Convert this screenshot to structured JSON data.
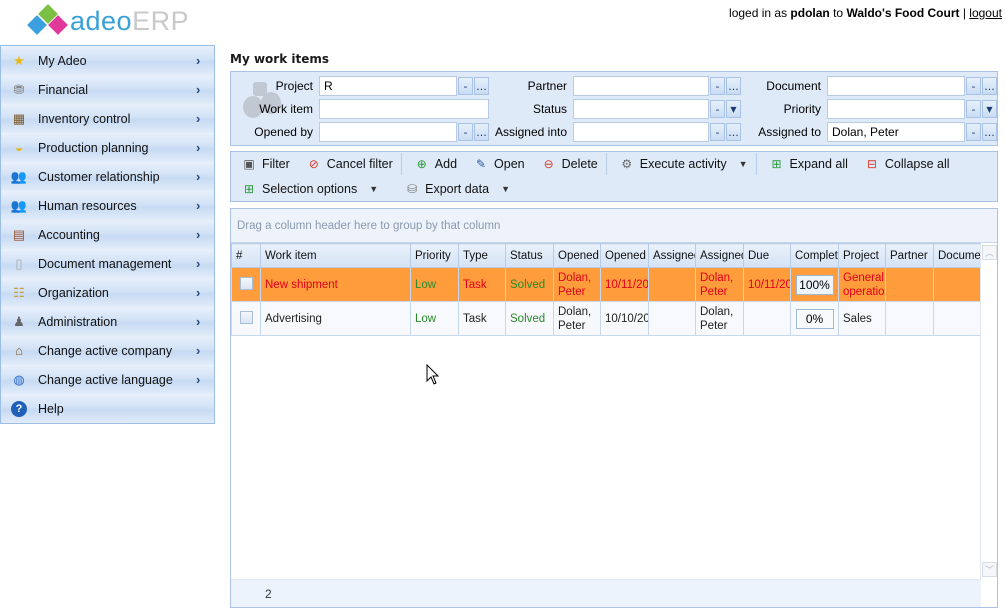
{
  "header": {
    "logo_part1": "adeo",
    "logo_part2": "ERP",
    "login_prefix": "loged in as ",
    "username": "pdolan",
    "login_mid": " to ",
    "company": "Waldo's Food Court",
    "separator": " | ",
    "logout_label": "logout"
  },
  "sidebar": {
    "items": [
      {
        "label": "My Adeo",
        "icon": "star-icon",
        "glyph": "★",
        "color": "#e8b80f"
      },
      {
        "label": "Financial",
        "icon": "coins-icon",
        "glyph": "⛃",
        "color": "#888888"
      },
      {
        "label": "Inventory control",
        "icon": "boxes-icon",
        "glyph": "▦",
        "color": "#7a5a2a"
      },
      {
        "label": "Production planning",
        "icon": "hardhat-icon",
        "glyph": "◒",
        "color": "#e8b80f"
      },
      {
        "label": "Customer relationship",
        "icon": "people-icon",
        "glyph": "👥",
        "color": "#2a6a4a"
      },
      {
        "label": "Human resources",
        "icon": "users-icon",
        "glyph": "👥",
        "color": "#d83a2a"
      },
      {
        "label": "Accounting",
        "icon": "abacus-icon",
        "glyph": "▤",
        "color": "#a0522d"
      },
      {
        "label": "Document management",
        "icon": "document-icon",
        "glyph": "▯",
        "color": "#aaaaaa"
      },
      {
        "label": "Organization",
        "icon": "org-chart-icon",
        "glyph": "☷",
        "color": "#c8a030"
      },
      {
        "label": "Administration",
        "icon": "admin-user-icon",
        "glyph": "♟",
        "color": "#666666"
      },
      {
        "label": "Change active company",
        "icon": "company-switch-icon",
        "glyph": "⌂",
        "color": "#8a5a2a"
      },
      {
        "label": "Change active language",
        "icon": "globe-icon",
        "glyph": "◍",
        "color": "#2a6ac8"
      },
      {
        "label": "Help",
        "icon": "help-icon",
        "glyph": "?",
        "color": "#1e5fb8"
      }
    ],
    "arrow": "›"
  },
  "page": {
    "title": "My work items"
  },
  "filters": {
    "project": {
      "label": "Project",
      "value": "R"
    },
    "work_item": {
      "label": "Work item",
      "value": ""
    },
    "opened_by": {
      "label": "Opened by",
      "value": ""
    },
    "partner": {
      "label": "Partner",
      "value": ""
    },
    "status": {
      "label": "Status",
      "value": ""
    },
    "assigned_into": {
      "label": "Assigned into",
      "value": ""
    },
    "document": {
      "label": "Document",
      "value": ""
    },
    "priority": {
      "label": "Priority",
      "value": ""
    },
    "assigned_to": {
      "label": "Assigned to",
      "value": "Dolan, Peter"
    },
    "clear_label": "-",
    "browse_label": "...",
    "dropdown_label": "▼"
  },
  "toolbar": {
    "filter": "Filter",
    "cancel_filter": "Cancel filter",
    "add": "Add",
    "open": "Open",
    "delete": "Delete",
    "execute_activity": "Execute activity",
    "expand_all": "Expand all",
    "collapse_all": "Collapse all",
    "selection_options": "Selection options",
    "export_data": "Export data",
    "caret": "▼"
  },
  "grid": {
    "group_hint": "Drag a column header here to group by that column",
    "columns": [
      "#",
      "Work item",
      "Priority",
      "Type",
      "Status",
      "Opened",
      "Opened o",
      "Assigned",
      "Assigned",
      "Due",
      "Complete",
      "Project",
      "Partner",
      "Document"
    ],
    "rows": [
      {
        "work_item": "New shipment",
        "priority": "Low",
        "type": "Task",
        "status": "Solved",
        "opened": "Dolan, Peter",
        "opened_on": "10/11/20",
        "assigned_into": "",
        "assigned": "Dolan, Peter",
        "due": "10/11/20",
        "complete": "100%",
        "project": "General operation",
        "partner": "",
        "document": "",
        "selected": true
      },
      {
        "work_item": "Advertising",
        "priority": "Low",
        "type": "Task",
        "status": "Solved",
        "opened": "Dolan, Peter",
        "opened_on": "10/10/20",
        "assigned_into": "",
        "assigned": "Dolan, Peter",
        "due": "",
        "complete": "0%",
        "project": "Sales",
        "partner": "",
        "document": "",
        "selected": false
      }
    ],
    "row_count": "2",
    "scroll_up": "︿",
    "scroll_down": "﹀"
  },
  "colors": {
    "selected_row": "#ff9c3b",
    "accent_blue": "#3aa0d8",
    "panel_bg": "#dfeaf8",
    "error_red": "#e0001b",
    "status_green": "#2a8a2a"
  }
}
